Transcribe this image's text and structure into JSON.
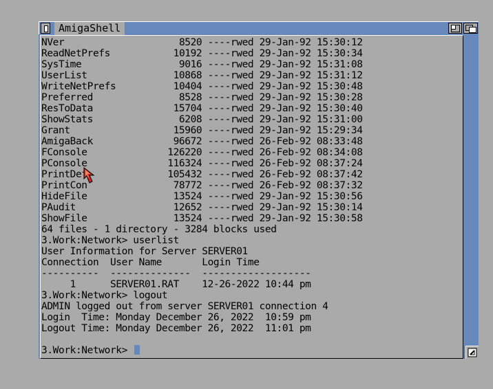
{
  "window": {
    "title": "AmigaShell"
  },
  "console": {
    "listing": [
      {
        "name": "NVer",
        "size": "8520",
        "perms": "----rwed",
        "date": "29-Jan-92",
        "time": "15:30:12"
      },
      {
        "name": "ReadNetPrefs",
        "size": "10192",
        "perms": "----rwed",
        "date": "29-Jan-92",
        "time": "15:30:34"
      },
      {
        "name": "SysTime",
        "size": "9016",
        "perms": "----rwed",
        "date": "29-Jan-92",
        "time": "15:31:08"
      },
      {
        "name": "UserList",
        "size": "10868",
        "perms": "----rwed",
        "date": "29-Jan-92",
        "time": "15:31:12"
      },
      {
        "name": "WriteNetPrefs",
        "size": "10404",
        "perms": "----rwed",
        "date": "29-Jan-92",
        "time": "15:30:48"
      },
      {
        "name": "Preferred",
        "size": "8528",
        "perms": "----rwed",
        "date": "29-Jan-92",
        "time": "15:30:28"
      },
      {
        "name": "ResToData",
        "size": "15704",
        "perms": "----rwed",
        "date": "29-Jan-92",
        "time": "15:30:40"
      },
      {
        "name": "ShowStats",
        "size": "6208",
        "perms": "----rwed",
        "date": "29-Jan-92",
        "time": "15:31:00"
      },
      {
        "name": "Grant",
        "size": "15960",
        "perms": "----rwed",
        "date": "29-Jan-92",
        "time": "15:29:34"
      },
      {
        "name": "AmigaBack",
        "size": "96672",
        "perms": "----rwed",
        "date": "26-Feb-92",
        "time": "08:33:48"
      },
      {
        "name": "FConsole",
        "size": "126220",
        "perms": "----rwed",
        "date": "26-Feb-92",
        "time": "08:34:08"
      },
      {
        "name": "PConsole",
        "size": "116324",
        "perms": "----rwed",
        "date": "26-Feb-92",
        "time": "08:37:24"
      },
      {
        "name": "PrintDef",
        "size": "105432",
        "perms": "----rwed",
        "date": "26-Feb-92",
        "time": "08:37:42"
      },
      {
        "name": "PrintCon",
        "size": "78772",
        "perms": "----rwed",
        "date": "26-Feb-92",
        "time": "08:37:32"
      },
      {
        "name": "HideFile",
        "size": "13524",
        "perms": "----rwed",
        "date": "29-Jan-92",
        "time": "15:30:56"
      },
      {
        "name": "PAudit",
        "size": "12652",
        "perms": "----rwed",
        "date": "29-Jan-92",
        "time": "15:30:14"
      },
      {
        "name": "ShowFile",
        "size": "13524",
        "perms": "----rwed",
        "date": "29-Jan-92",
        "time": "15:30:58"
      }
    ],
    "summary": "64 files - 1 directory - 3284 blocks used",
    "prompt_1": "3.Work:Network> userlist",
    "userlist_title": "User Information for Server SERVER01",
    "userlist_header": "Connection  User Name       Login Time",
    "userlist_divider": "----------  --------------  -------------------",
    "userlist_row": "     1      SERVER01.RAT    12-26-2022 10:44 pm",
    "prompt_2": "3.Work:Network> logout",
    "logout_msg": "ADMIN logged out from server SERVER01 connection 4",
    "login_time": "Login  Time: Monday December 26, 2022  10:59 pm",
    "logout_time": "Logout Time: Monday December 26, 2022  11:01 pm",
    "blank": "",
    "prompt_current": "3.Work:Network> "
  },
  "colors": {
    "amiga_blue": "#6688bb",
    "amiga_grey": "#aaaaaa",
    "pointer_red": "#dd2222"
  }
}
